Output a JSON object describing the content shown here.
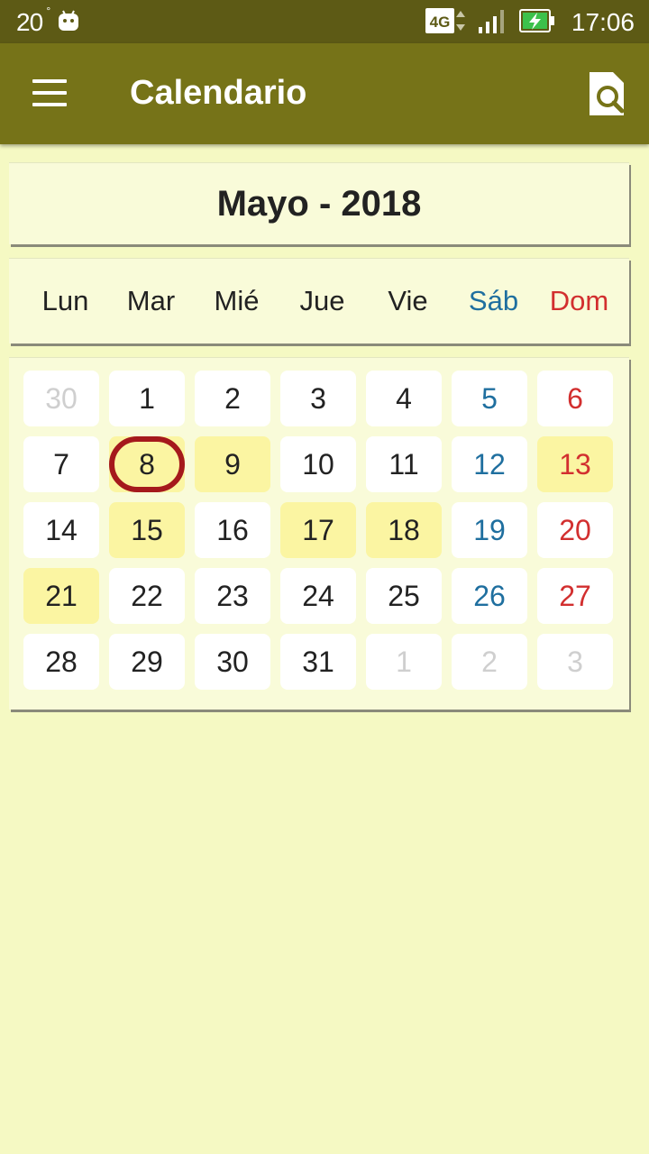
{
  "status_bar": {
    "temperature": "20",
    "degree_symbol": "°",
    "network": "4G",
    "time": "17:06"
  },
  "app_bar": {
    "title": "Calendario",
    "menu_icon": "hamburger-menu-icon",
    "search_icon": "page-search-icon"
  },
  "month_header": {
    "label": "Mayo - 2018"
  },
  "weekdays": [
    "Lun",
    "Mar",
    "Mié",
    "Jue",
    "Vie",
    "Sáb",
    "Dom"
  ],
  "colors": {
    "status_bar": "#5d5a15",
    "app_bar": "#767318",
    "background": "#f5f9c3",
    "highlight_day": "#fbf5a2",
    "saturday": "#1f6f9f",
    "sunday": "#d22f2f",
    "today_ring": "#a5191c",
    "other_month": "#cfcfcf"
  },
  "calendar": {
    "days": [
      {
        "label": "30",
        "other": true
      },
      {
        "label": "1"
      },
      {
        "label": "2"
      },
      {
        "label": "3"
      },
      {
        "label": "4"
      },
      {
        "label": "5"
      },
      {
        "label": "6"
      },
      {
        "label": "7"
      },
      {
        "label": "8",
        "today": true,
        "highlight": true
      },
      {
        "label": "9",
        "highlight": true
      },
      {
        "label": "10"
      },
      {
        "label": "11"
      },
      {
        "label": "12"
      },
      {
        "label": "13",
        "highlight": true
      },
      {
        "label": "14"
      },
      {
        "label": "15",
        "highlight": true
      },
      {
        "label": "16"
      },
      {
        "label": "17",
        "highlight": true
      },
      {
        "label": "18",
        "highlight": true
      },
      {
        "label": "19"
      },
      {
        "label": "20"
      },
      {
        "label": "21",
        "highlight": true
      },
      {
        "label": "22"
      },
      {
        "label": "23"
      },
      {
        "label": "24"
      },
      {
        "label": "25"
      },
      {
        "label": "26"
      },
      {
        "label": "27"
      },
      {
        "label": "28"
      },
      {
        "label": "29"
      },
      {
        "label": "30"
      },
      {
        "label": "31"
      },
      {
        "label": "1",
        "other": true
      },
      {
        "label": "2",
        "other": true
      },
      {
        "label": "3",
        "other": true
      }
    ]
  }
}
